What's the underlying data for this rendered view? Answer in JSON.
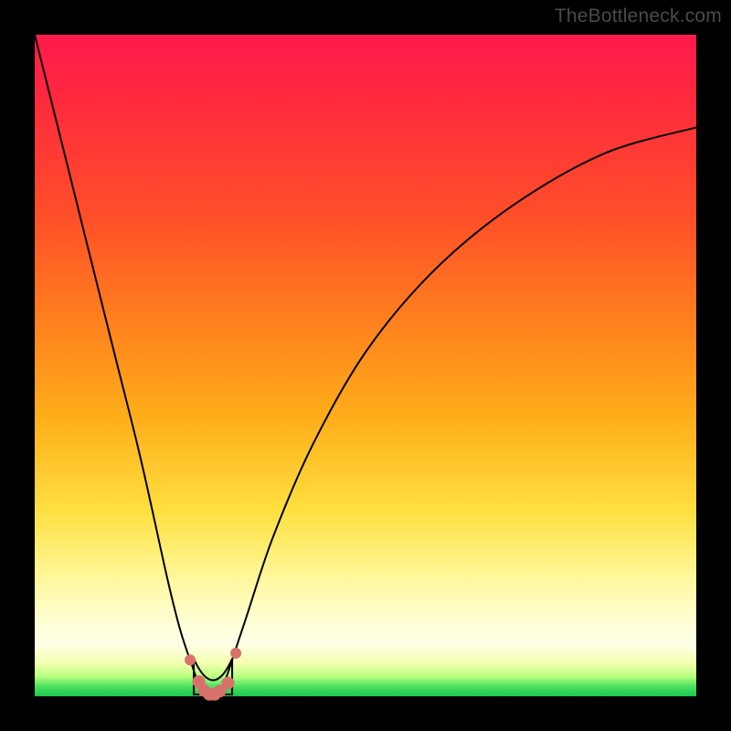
{
  "watermark": "TheBottleneck.com",
  "colors": {
    "frame": "#000000",
    "curve": "#000000",
    "marker": "#d9716b",
    "gradient_top": "#ff1a4d",
    "gradient_bottom": "#18c850"
  },
  "chart_data": {
    "type": "line",
    "title": "",
    "xlabel": "",
    "ylabel": "",
    "xlim": [
      0,
      100
    ],
    "ylim": [
      0,
      100
    ],
    "note": "Bottleneck-style V-curve. x is an arbitrary balance axis (no ticks shown); y is bottleneck percentage (0 at bottom, 100 at top). Curve reaches ~0 at the trough near x≈26 and rises steeply on both sides. A cluster of salmon markers sits at the trough.",
    "series": [
      {
        "name": "bottleneck_curve",
        "x": [
          0,
          4,
          8,
          12,
          16,
          20,
          22,
          24,
          25,
          26,
          27,
          28,
          29,
          30,
          32,
          36,
          42,
          50,
          60,
          72,
          86,
          100
        ],
        "y": [
          100,
          84,
          68,
          52,
          36,
          18,
          10,
          4,
          1,
          0,
          0,
          1,
          3,
          6,
          12,
          24,
          38,
          52,
          64,
          74,
          82,
          86
        ]
      }
    ],
    "markers": {
      "name": "trough_points",
      "x": [
        23.5,
        24.8,
        25.6,
        26.4,
        27.2,
        28.0,
        29.2,
        30.4
      ],
      "y": [
        5.5,
        2.2,
        0.9,
        0.3,
        0.3,
        0.8,
        2.0,
        6.5
      ]
    }
  }
}
